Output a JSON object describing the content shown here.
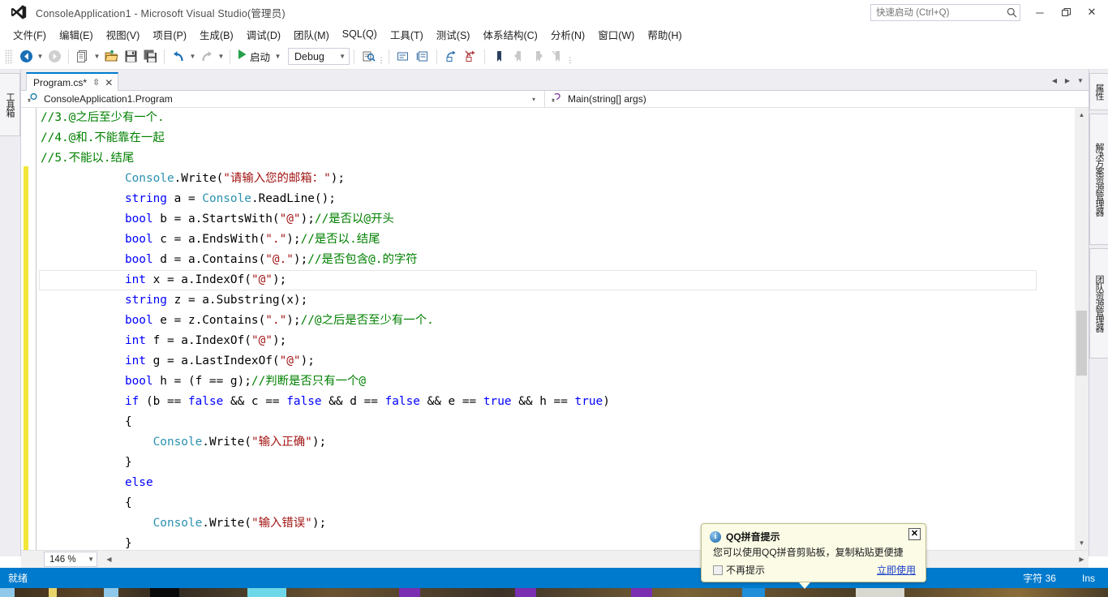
{
  "titlebar": {
    "title": "ConsoleApplication1 - Microsoft Visual Studio(管理员)",
    "logo_icon": "visual-studio-logo",
    "quick_launch_placeholder": "快速启动 (Ctrl+Q)",
    "quick_launch_value": "",
    "search_icon": "search-icon",
    "minimize": "─",
    "maximize": "❐",
    "close": "✕"
  },
  "menubar": {
    "items": [
      {
        "label": "文件(F)",
        "accel": "F"
      },
      {
        "label": "编辑(E)",
        "accel": "E"
      },
      {
        "label": "视图(V)",
        "accel": "V"
      },
      {
        "label": "项目(P)",
        "accel": "P"
      },
      {
        "label": "生成(B)",
        "accel": "B"
      },
      {
        "label": "调试(D)",
        "accel": "D"
      },
      {
        "label": "团队(M)",
        "accel": "M"
      },
      {
        "label": "SQL(Q)",
        "accel": "Q"
      },
      {
        "label": "工具(T)",
        "accel": "T"
      },
      {
        "label": "测试(S)",
        "accel": "S"
      },
      {
        "label": "体系结构(C)",
        "accel": "C"
      },
      {
        "label": "分析(N)",
        "accel": "N"
      },
      {
        "label": "窗口(W)",
        "accel": "W"
      },
      {
        "label": "帮助(H)",
        "accel": "H"
      }
    ]
  },
  "toolbar": {
    "navigate_back_icon": "navigate-back-icon",
    "navigate_forward_icon": "navigate-forward-icon",
    "new_project_icon": "new-project-icon",
    "open_file_icon": "open-file-icon",
    "save_icon": "save-icon",
    "save_all_icon": "save-all-icon",
    "undo_icon": "undo-icon",
    "redo_icon": "redo-icon",
    "start_icon": "start-debug-play-icon",
    "start_label": "启动",
    "config_value": "Debug",
    "config_caret": "▼",
    "find_icon": "find-in-files-icon",
    "comment_icon": "comment-selection-icon",
    "uncomment_icon": "uncomment-selection-icon",
    "indent_icon": "increase-indent-icon",
    "outdent_icon": "decrease-indent-icon",
    "bookmark_icon": "bookmark-icon",
    "prev_bookmark_icon": "previous-bookmark-icon",
    "next_bookmark_icon": "next-bookmark-icon",
    "clear_bookmark_icon": "clear-bookmarks-icon"
  },
  "left_dock": {
    "tabs": [
      {
        "label": "工具箱",
        "icon": "toolbox-icon"
      }
    ]
  },
  "right_dock": {
    "tabs": [
      {
        "label": "属性"
      },
      {
        "label": "解决方案资源管理器"
      },
      {
        "label": "团队资源管理器"
      }
    ]
  },
  "tabstrip": {
    "tab_label": "Program.cs*",
    "pin_icon": "pin-icon",
    "close_icon": "close-icon",
    "scroll_left_icon": "chevron-left-icon",
    "scroll_right_icon": "chevron-right-icon",
    "tab_list_icon": "chevron-down-icon"
  },
  "navbar": {
    "type_icon": "class-icon",
    "type_value": "ConsoleApplication1.Program",
    "type_caret": "▾",
    "member_icon": "method-icon",
    "member_value": "Main(string[] args)",
    "member_caret": "▾"
  },
  "editor": {
    "zoom_level": "146 %",
    "zoom_caret": "▾",
    "current_line_index": 8,
    "lines": [
      [
        {
          "t": "c",
          "v": "//3.@之后至少有一个."
        }
      ],
      [
        {
          "t": "c",
          "v": "//4.@和.不能靠在一起"
        }
      ],
      [
        {
          "t": "c",
          "v": "//5.不能以.结尾"
        }
      ],
      [
        {
          "t": "p",
          "v": "            "
        },
        {
          "t": "t",
          "v": "Console"
        },
        {
          "t": "p",
          "v": ".Write("
        },
        {
          "t": "s",
          "v": "\"请输入您的邮箱：\""
        },
        {
          "t": "p",
          "v": ");"
        }
      ],
      [
        {
          "t": "p",
          "v": "            "
        },
        {
          "t": "k",
          "v": "string"
        },
        {
          "t": "p",
          "v": " a = "
        },
        {
          "t": "t",
          "v": "Console"
        },
        {
          "t": "p",
          "v": ".ReadLine();"
        }
      ],
      [
        {
          "t": "p",
          "v": "            "
        },
        {
          "t": "k",
          "v": "bool"
        },
        {
          "t": "p",
          "v": " b = a.StartsWith("
        },
        {
          "t": "s",
          "v": "\"@\""
        },
        {
          "t": "p",
          "v": ");"
        },
        {
          "t": "c",
          "v": "//是否以@开头"
        }
      ],
      [
        {
          "t": "p",
          "v": "            "
        },
        {
          "t": "k",
          "v": "bool"
        },
        {
          "t": "p",
          "v": " c = a.EndsWith("
        },
        {
          "t": "s",
          "v": "\".\""
        },
        {
          "t": "p",
          "v": ");"
        },
        {
          "t": "c",
          "v": "//是否以.结尾"
        }
      ],
      [
        {
          "t": "p",
          "v": "            "
        },
        {
          "t": "k",
          "v": "bool"
        },
        {
          "t": "p",
          "v": " d = a.Contains("
        },
        {
          "t": "s",
          "v": "\"@.\""
        },
        {
          "t": "p",
          "v": ");"
        },
        {
          "t": "c",
          "v": "//是否包含@.的字符"
        }
      ],
      [
        {
          "t": "p",
          "v": "            "
        },
        {
          "t": "k",
          "v": "int"
        },
        {
          "t": "p",
          "v": " x = a.IndexOf("
        },
        {
          "t": "s",
          "v": "\"@\""
        },
        {
          "t": "p",
          "v": ");"
        }
      ],
      [
        {
          "t": "p",
          "v": "            "
        },
        {
          "t": "k",
          "v": "string"
        },
        {
          "t": "p",
          "v": " z = a.Substring(x);"
        }
      ],
      [
        {
          "t": "p",
          "v": "            "
        },
        {
          "t": "k",
          "v": "bool"
        },
        {
          "t": "p",
          "v": " e = z.Contains("
        },
        {
          "t": "s",
          "v": "\".\""
        },
        {
          "t": "p",
          "v": ");"
        },
        {
          "t": "c",
          "v": "//@之后是否至少有一个."
        }
      ],
      [
        {
          "t": "p",
          "v": "            "
        },
        {
          "t": "k",
          "v": "int"
        },
        {
          "t": "p",
          "v": " f = a.IndexOf("
        },
        {
          "t": "s",
          "v": "\"@\""
        },
        {
          "t": "p",
          "v": ");"
        }
      ],
      [
        {
          "t": "p",
          "v": "            "
        },
        {
          "t": "k",
          "v": "int"
        },
        {
          "t": "p",
          "v": " g = a.LastIndexOf("
        },
        {
          "t": "s",
          "v": "\"@\""
        },
        {
          "t": "p",
          "v": ");"
        }
      ],
      [
        {
          "t": "p",
          "v": "            "
        },
        {
          "t": "k",
          "v": "bool"
        },
        {
          "t": "p",
          "v": " h = (f == g);"
        },
        {
          "t": "c",
          "v": "//判断是否只有一个@"
        }
      ],
      [
        {
          "t": "p",
          "v": "            "
        },
        {
          "t": "k",
          "v": "if"
        },
        {
          "t": "p",
          "v": " (b == "
        },
        {
          "t": "k",
          "v": "false"
        },
        {
          "t": "p",
          "v": " && c == "
        },
        {
          "t": "k",
          "v": "false"
        },
        {
          "t": "p",
          "v": " && d == "
        },
        {
          "t": "k",
          "v": "false"
        },
        {
          "t": "p",
          "v": " && e == "
        },
        {
          "t": "k",
          "v": "true"
        },
        {
          "t": "p",
          "v": " && h == "
        },
        {
          "t": "k",
          "v": "true"
        },
        {
          "t": "p",
          "v": ")"
        }
      ],
      [
        {
          "t": "p",
          "v": "            {"
        }
      ],
      [
        {
          "t": "p",
          "v": "                "
        },
        {
          "t": "t",
          "v": "Console"
        },
        {
          "t": "p",
          "v": ".Write("
        },
        {
          "t": "s",
          "v": "\"输入正确\""
        },
        {
          "t": "p",
          "v": ");"
        }
      ],
      [
        {
          "t": "p",
          "v": "            }"
        }
      ],
      [
        {
          "t": "p",
          "v": "            "
        },
        {
          "t": "k",
          "v": "else"
        }
      ],
      [
        {
          "t": "p",
          "v": "            {"
        }
      ],
      [
        {
          "t": "p",
          "v": "                "
        },
        {
          "t": "t",
          "v": "Console"
        },
        {
          "t": "p",
          "v": ".Write("
        },
        {
          "t": "s",
          "v": "\"输入错误\""
        },
        {
          "t": "p",
          "v": ");"
        }
      ],
      [
        {
          "t": "p",
          "v": "            }"
        }
      ]
    ],
    "colors": {
      "keyword": "#0000FF",
      "type": "#2B91AF",
      "string": "#A31515",
      "comment": "#008000",
      "plain": "#000000",
      "change_bar_unsaved": "#F2E63A"
    }
  },
  "statusbar": {
    "ready_text": "就绪",
    "char_text": "字符 36",
    "insert_mode": "Ins",
    "accent_color": "#007ACC"
  },
  "qq_popup": {
    "info_icon": "info-icon",
    "title": "QQ拼音提示",
    "body": "您可以使用QQ拼音剪贴板，复制粘贴更便捷",
    "checkbox_label": "不再提示",
    "checkbox_checked": false,
    "link_label": "立即使用",
    "close_icon": "close-icon"
  }
}
